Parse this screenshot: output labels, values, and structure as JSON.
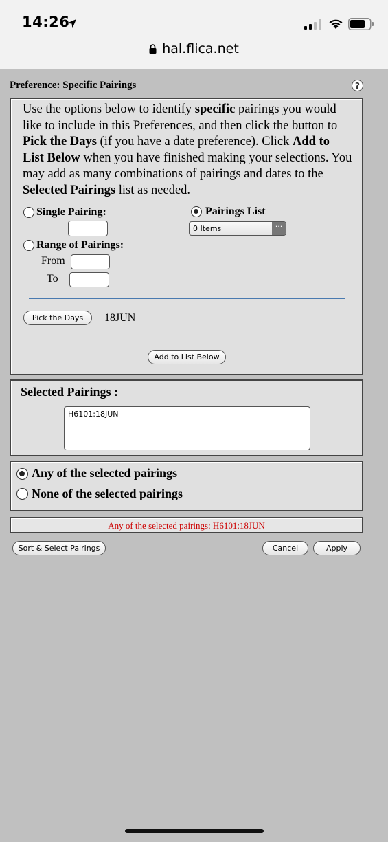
{
  "status_bar": {
    "time": "14:26",
    "url": "hal.flica.net"
  },
  "page": {
    "title": "Preference: Specific Pairings",
    "help_label": "?"
  },
  "instructions": {
    "p1": "Use the options below to identify ",
    "b1": "specific",
    "p2": " pairings you would like to include in this Preferences, and then click the button to ",
    "b2": "Pick the Days",
    "p3": " (if you have a date preference). Click ",
    "b3": "Add to List Below",
    "p4": " when you have finished making your selections. You may add as many combinations of pairings and dates to the ",
    "b4": "Selected Pairings",
    "p5": " list as needed."
  },
  "options": {
    "single_pairing_label": "Single Pairing:",
    "pairings_list_label": "Pairings List",
    "pairings_list_value": "0 Items",
    "pairings_list_button": "···",
    "range_label": "Range of Pairings:",
    "from_label": "From",
    "to_label": "To"
  },
  "pick_days": {
    "button_label": "Pick the Days",
    "value": "18JUN"
  },
  "add_button_label": "Add to List Below",
  "selected": {
    "title": "Selected Pairings :",
    "items": [
      "H6101:18JUN"
    ]
  },
  "match": {
    "any_label": "Any of the selected pairings",
    "none_label": "None of the selected pairings"
  },
  "summary": "Any of the selected pairings: H6101:18JUN",
  "footer": {
    "sort_label": "Sort & Select Pairings",
    "cancel_label": "Cancel",
    "apply_label": "Apply"
  }
}
